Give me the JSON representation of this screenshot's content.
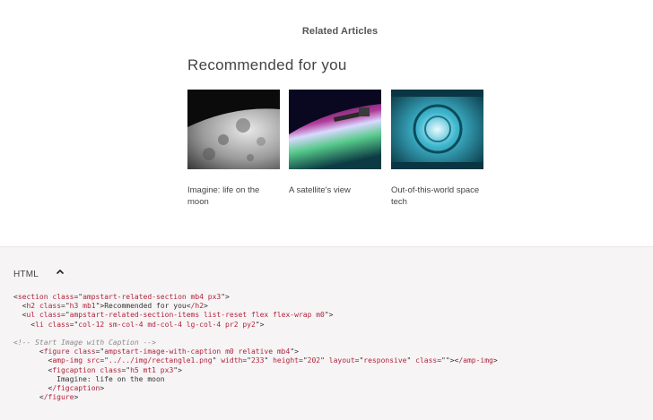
{
  "preview": {
    "section_label": "Related Articles",
    "heading": "Recommended for you",
    "articles": [
      {
        "title": "Imagine: life on the moon",
        "image": "moon-surface-image"
      },
      {
        "title": "A satellite's view",
        "image": "satellite-earth-image"
      },
      {
        "title": "Out-of-this-world space tech",
        "image": "space-station-interior-image"
      }
    ]
  },
  "code_panel": {
    "label": "HTML",
    "toggle_icon": "chevron-up-icon",
    "lines": {
      "l1": {
        "tag": "section",
        "attr": "class",
        "val": "ampstart-related-section mb4 px3"
      },
      "l2": {
        "tag": "h2",
        "attr": "class",
        "val": "h3 mb1",
        "text": "Recommended for you",
        "close": "/h2"
      },
      "l3": {
        "tag": "ul",
        "attr": "class",
        "val": "ampstart-related-section-items list-reset flex flex-wrap m0"
      },
      "l4": {
        "tag": "li",
        "attr": "class",
        "val": "col-12 sm-col-4 md-col-4 lg-col-4 pr2 py2"
      },
      "l5": {
        "comment": "<!-- Start Image with Caption -->"
      },
      "l6": {
        "tag": "figure",
        "attr": "class",
        "val": "ampstart-image-with-caption m0 relative mb4"
      },
      "l7": {
        "tag": "amp-img",
        "a1": "src",
        "v1": "../../img/rectangle1.png",
        "a2": "width",
        "v2": "233",
        "a3": "height",
        "v3": "202",
        "a4": "layout",
        "v4": "responsive",
        "a5": "class",
        "v5": "",
        "close": "/amp-img"
      },
      "l8": {
        "tag": "figcaption",
        "attr": "class",
        "val": "h5 mt1 px3"
      },
      "l9": {
        "text": "Imagine: life on the moon"
      },
      "l10": {
        "close": "/figcaption"
      },
      "l11": {
        "close": "/figure"
      }
    }
  },
  "colors": {
    "tag": "#b0233b",
    "comment": "#8a8a8a",
    "panel_bg": "#f7f4f5"
  }
}
